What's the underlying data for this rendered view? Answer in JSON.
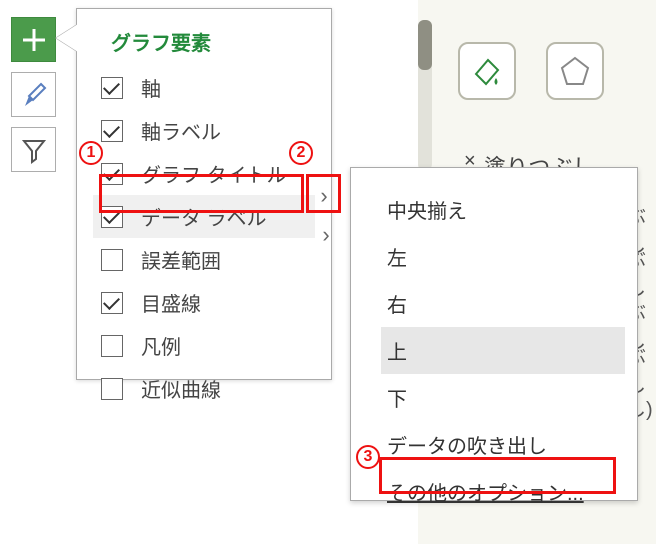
{
  "toolbar": {
    "plus": "plus",
    "brush": "brush",
    "funnel": "funnel"
  },
  "callout_title": "グラフ要素",
  "chart_elements": [
    {
      "label": "軸",
      "checked": true
    },
    {
      "label": "軸ラベル",
      "checked": true
    },
    {
      "label": "グラフ タイトル",
      "checked": true
    },
    {
      "label": "データ ラベル",
      "checked": true,
      "highlight": true
    },
    {
      "label": "誤差範囲",
      "checked": false
    },
    {
      "label": "目盛線",
      "checked": true
    },
    {
      "label": "凡例",
      "checked": false
    },
    {
      "label": "近似曲線",
      "checked": false
    }
  ],
  "flyout": [
    {
      "label": "中央揃え"
    },
    {
      "label": "左"
    },
    {
      "label": "右"
    },
    {
      "label": "上",
      "hover": true
    },
    {
      "label": "下"
    },
    {
      "label": "データの吹き出し"
    },
    {
      "label": "その他のオプション...",
      "link": true
    }
  ],
  "annotations": {
    "n1": "1",
    "n2": "2",
    "n3": "3"
  },
  "right_panel": {
    "section_title": "塗りつぶし",
    "close": "×",
    "partial_hint1": "ぶし",
    "partial_hint2": "ぶし",
    "partial_hint3": "ぶし",
    "partial_hint4": "ぶし",
    "partial_hint5": "し)"
  },
  "chevron": "›"
}
